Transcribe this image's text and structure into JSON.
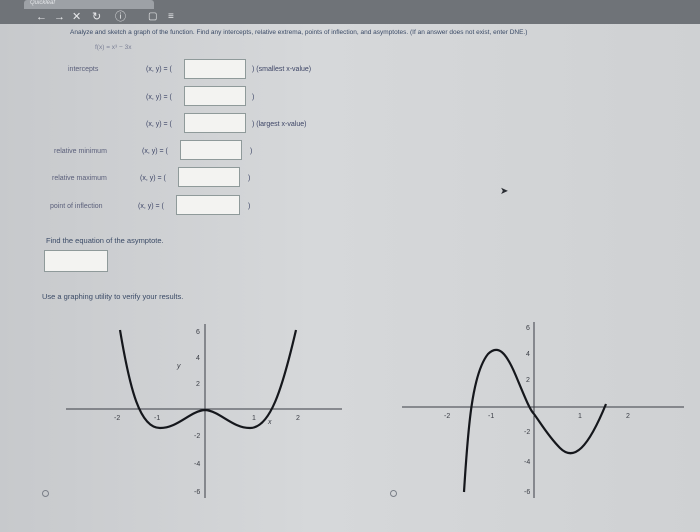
{
  "browser": {
    "tab_title": "Quickleaf",
    "nav_icons": [
      "back-arrow-icon",
      "forward-arrow-icon",
      "close-icon",
      "reload-icon",
      "info-icon",
      "page-icon",
      "menu-icon"
    ]
  },
  "question": {
    "instruction": "Analyze and sketch a graph of the function. Find any intercepts, relative extrema, points of inflection, and asymptotes. (If an answer does not exist, enter DNE.)",
    "function": "f(x) = x³ − 3x"
  },
  "rows": [
    {
      "label": "intercepts",
      "prefix": "(x, y) = (",
      "value": "",
      "suffix": ") (smallest x-value)"
    },
    {
      "label": "",
      "prefix": "(x, y) = (",
      "value": "",
      "suffix": ")"
    },
    {
      "label": "",
      "prefix": "(x, y) = (",
      "value": "",
      "suffix": ") (largest x-value)"
    },
    {
      "label": "relative minimum",
      "prefix": "(x, y) = (",
      "value": "",
      "suffix": ")"
    },
    {
      "label": "relative maximum",
      "prefix": "(x, y) = (",
      "value": "",
      "suffix": ")"
    },
    {
      "label": "point of inflection",
      "prefix": "(x, y) = (",
      "value": "",
      "suffix": ")"
    }
  ],
  "asymptote": {
    "prompt": "Find the equation of the asymptote.",
    "value": ""
  },
  "verify_text": "Use a graphing utility to verify your results.",
  "graphs": [
    {
      "option": "graph-option-1",
      "selected": false,
      "x_ticks": [
        "-2",
        "-1",
        "1",
        "2"
      ],
      "y_ticks": [
        "6",
        "4",
        "2",
        "-2",
        "-4",
        "-6"
      ],
      "axis_labels": {
        "x": "x",
        "y": "y"
      }
    },
    {
      "option": "graph-option-2",
      "selected": false,
      "x_ticks": [
        "-2",
        "-1",
        "1",
        "2"
      ],
      "y_ticks": [
        "6",
        "4",
        "2",
        "-2",
        "-4",
        "-6"
      ],
      "axis_labels": {
        "x": "",
        "y": ""
      }
    }
  ]
}
